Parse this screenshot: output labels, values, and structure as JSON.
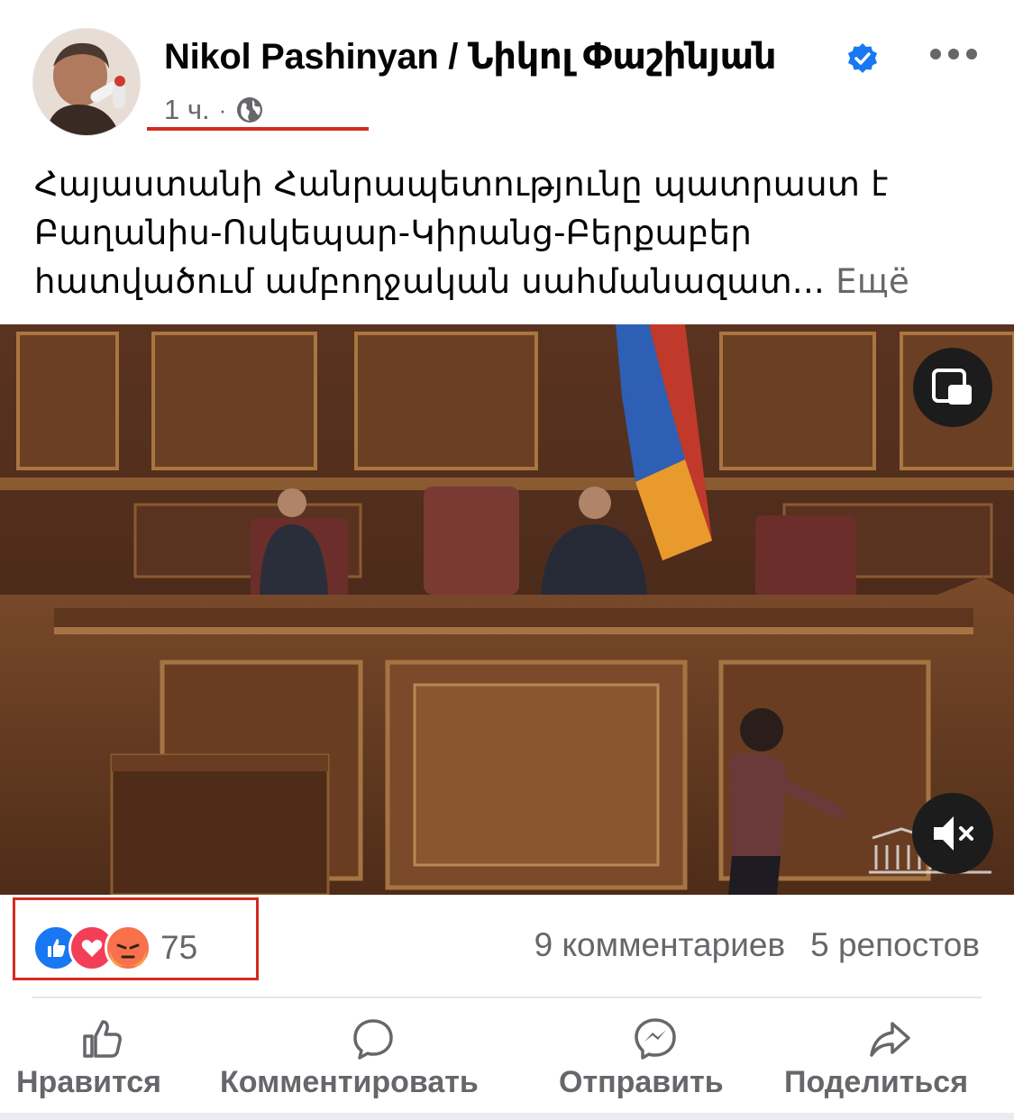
{
  "post": {
    "author": "Nikol Pashinyan / Նիկոլ Փաշինյան",
    "time": "1 ч.",
    "dot": "·",
    "text_lines": [
      "Հայաստանի Հանրապետությունը պատրաստ է",
      "Բաղանիս-Ոսկեպար-Կիրանց-Բերքաբեր",
      "հատվածում ամբողջական սահմանազատ..."
    ],
    "see_more": "Ещё"
  },
  "engagement": {
    "reaction_count": "75",
    "reaction_icons": [
      "like-icon",
      "love-icon",
      "angry-icon"
    ],
    "comments": "9 комментариев",
    "shares": "5 репостов"
  },
  "actions": {
    "like": "Нравится",
    "comment": "Комментировать",
    "send": "Отправить",
    "share": "Поделиться"
  },
  "colors": {
    "verified": "#1877f2",
    "like": "#1877f2",
    "love": "#f33e58",
    "angry": "#f7714c",
    "annotation_red": "#d42a1f",
    "secondary_text": "#65676b"
  }
}
